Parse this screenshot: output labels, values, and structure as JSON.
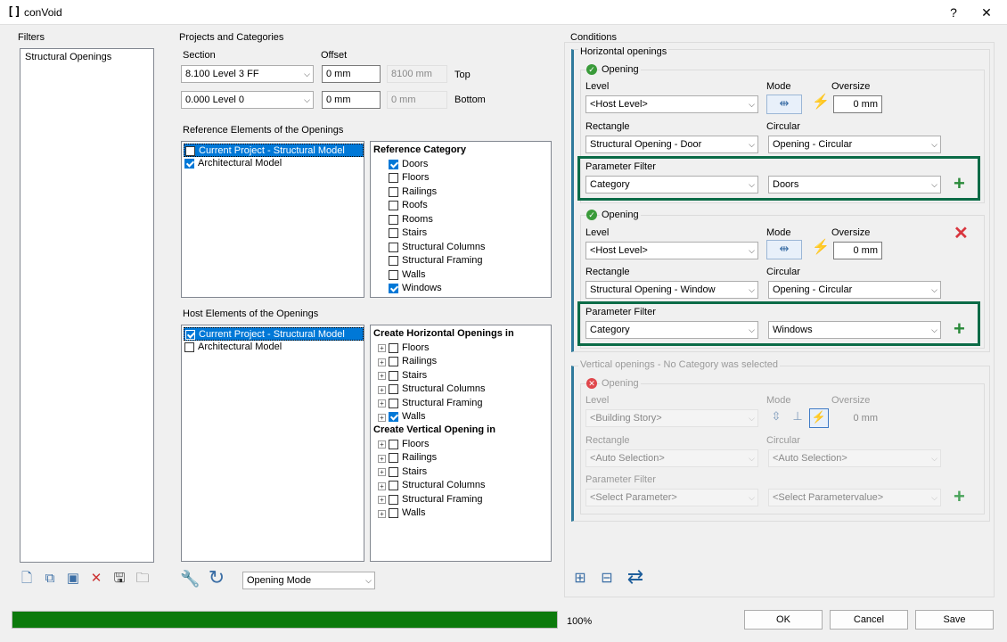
{
  "window": {
    "title": "conVoid",
    "help": "?",
    "close": "✕"
  },
  "filters": {
    "title": "Filters",
    "items": [
      "Structural Openings"
    ]
  },
  "projects": {
    "title": "Projects and Categories",
    "section_label": "Section",
    "offset_label": "Offset",
    "top": {
      "level": "8.100  Level 3 FF",
      "offset": "0 mm",
      "computed": "8100 mm",
      "label": "Top"
    },
    "bottom": {
      "level": "0.000  Level 0",
      "offset": "0 mm",
      "computed": "0 mm",
      "label": "Bottom"
    },
    "ref_title": "Reference Elements of the Openings",
    "ref_models": [
      {
        "label": "Current Project - Structural Model",
        "checked": false,
        "selected": true
      },
      {
        "label": "Architectural Model",
        "checked": true,
        "selected": false
      }
    ],
    "ref_category_head": "Reference Category",
    "ref_categories": [
      {
        "label": "Doors",
        "checked": true
      },
      {
        "label": "Floors",
        "checked": false
      },
      {
        "label": "Railings",
        "checked": false
      },
      {
        "label": "Roofs",
        "checked": false
      },
      {
        "label": "Rooms",
        "checked": false
      },
      {
        "label": "Stairs",
        "checked": false
      },
      {
        "label": "Structural Columns",
        "checked": false
      },
      {
        "label": "Structural Framing",
        "checked": false
      },
      {
        "label": "Walls",
        "checked": false
      },
      {
        "label": "Windows",
        "checked": true
      }
    ],
    "host_title": "Host Elements of the Openings",
    "host_models": [
      {
        "label": "Current Project - Structural Model",
        "checked": true,
        "selected": true
      },
      {
        "label": "Architectural Model",
        "checked": false,
        "selected": false
      }
    ],
    "horiz_head": "Create Horizontal Openings in",
    "horiz_items": [
      {
        "label": "Floors",
        "checked": false
      },
      {
        "label": "Railings",
        "checked": false
      },
      {
        "label": "Stairs",
        "checked": false
      },
      {
        "label": "Structural Columns",
        "checked": false
      },
      {
        "label": "Structural Framing",
        "checked": false
      },
      {
        "label": "Walls",
        "checked": true
      }
    ],
    "vert_head": "Create Vertical Opening in",
    "vert_items": [
      {
        "label": "Floors",
        "checked": false
      },
      {
        "label": "Railings",
        "checked": false
      },
      {
        "label": "Stairs",
        "checked": false
      },
      {
        "label": "Structural Columns",
        "checked": false
      },
      {
        "label": "Structural Framing",
        "checked": false
      },
      {
        "label": "Walls",
        "checked": false
      }
    ],
    "mode_select": "Opening Mode"
  },
  "conditions": {
    "title": "Conditions",
    "horizontal": {
      "title": "Horizontal openings",
      "openings": [
        {
          "title": "Opening",
          "level_label": "Level",
          "level": "<Host Level>",
          "mode_label": "Mode",
          "oversize_label": "Oversize",
          "oversize": "0 mm",
          "rect_label": "Rectangle",
          "rect": "Structural Opening - Door",
          "circ_label": "Circular",
          "circ": "Opening - Circular",
          "pf_label": "Parameter Filter",
          "pf_param": "Category",
          "pf_value": "Doors"
        },
        {
          "title": "Opening",
          "level_label": "Level",
          "level": "<Host Level>",
          "mode_label": "Mode",
          "oversize_label": "Oversize",
          "oversize": "0 mm",
          "rect_label": "Rectangle",
          "rect": "Structural Opening - Window",
          "circ_label": "Circular",
          "circ": "Opening - Circular",
          "pf_label": "Parameter Filter",
          "pf_param": "Category",
          "pf_value": "Windows"
        }
      ]
    },
    "vertical": {
      "title": "Vertical openings - No Category was selected",
      "opening": {
        "title": "Opening",
        "level_label": "Level",
        "level": "<Building Story>",
        "mode_label": "Mode",
        "oversize_label": "Oversize",
        "oversize": "0 mm",
        "rect_label": "Rectangle",
        "rect": "<Auto Selection>",
        "circ_label": "Circular",
        "circ": "<Auto Selection>",
        "pf_label": "Parameter Filter",
        "pf_param": "<Select Parameter>",
        "pf_value": "<Select Parametervalue>"
      }
    }
  },
  "footer": {
    "progress": 1.0,
    "progress_text": "100%",
    "ok": "OK",
    "cancel": "Cancel",
    "save": "Save"
  },
  "colors": {
    "accent": "#0078d7",
    "progress": "#0c7a0c",
    "highlight": "#0b6b47"
  }
}
